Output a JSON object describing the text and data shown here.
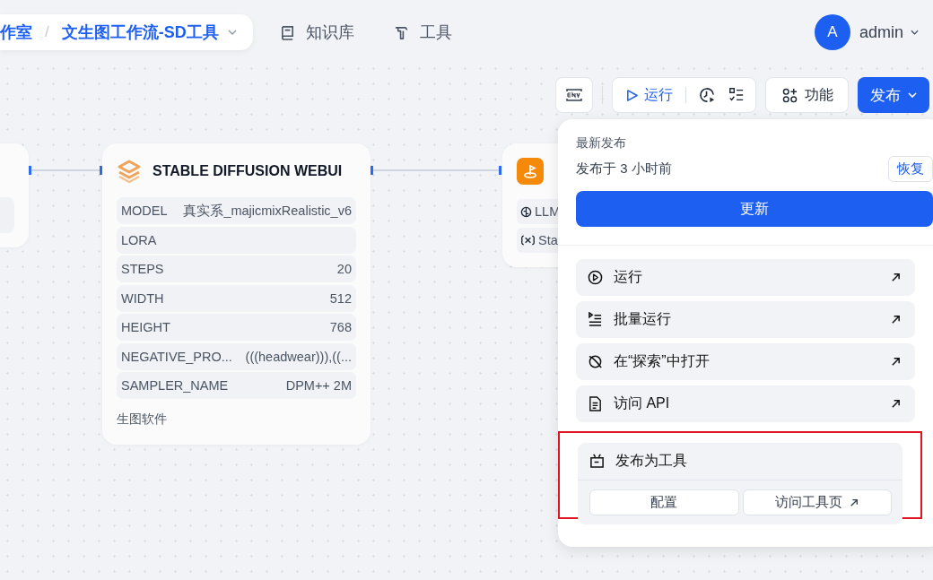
{
  "breadcrumb": {
    "separator": "/",
    "items": [
      "作室",
      "文生图工作流-SD工具"
    ]
  },
  "nav": [
    {
      "kind": "book",
      "label": "知识库"
    },
    {
      "kind": "hammer",
      "label": "工具"
    }
  ],
  "user": {
    "avatar": "A",
    "name": "admin"
  },
  "toolbar": {
    "run": "运行",
    "features": "功能",
    "publish": "发布"
  },
  "sd_node": {
    "title": "STABLE DIFFUSION WEBUI",
    "footer": "生图软件",
    "rows": [
      {
        "label": "MODEL",
        "value": "真实系_majicmixRealistic_v6"
      },
      {
        "label": "LORA"
      },
      {
        "label": "STEPS",
        "value": "20"
      },
      {
        "label": "WIDTH",
        "value": "512"
      },
      {
        "label": "HEIGHT",
        "value": "768"
      },
      {
        "label": "NEGATIVE_PRO...",
        "value": "(((headwear))),((..."
      },
      {
        "label": "SAMPLER_NAME",
        "value": "DPM++ 2M"
      }
    ]
  },
  "end_node": {
    "rows": [
      {
        "kind": "llm",
        "label": "LLM"
      },
      {
        "kind": "var",
        "label": "Sta"
      }
    ]
  },
  "publish_menu": {
    "heading": "最新发布",
    "status": "发布于 3 小时前",
    "restore": "恢复",
    "update": "更新",
    "items": [
      {
        "kind": "run",
        "label": "运行"
      },
      {
        "kind": "batch",
        "label": "批量运行"
      },
      {
        "kind": "explore",
        "label": "在“探索”中打开"
      },
      {
        "kind": "api",
        "label": "访问 API"
      }
    ],
    "tool_section": {
      "title": "发布为工具",
      "highlighted": true,
      "buttons": [
        {
          "label": "配置",
          "external": false
        },
        {
          "label": "访问工具页",
          "external": true
        }
      ]
    }
  }
}
